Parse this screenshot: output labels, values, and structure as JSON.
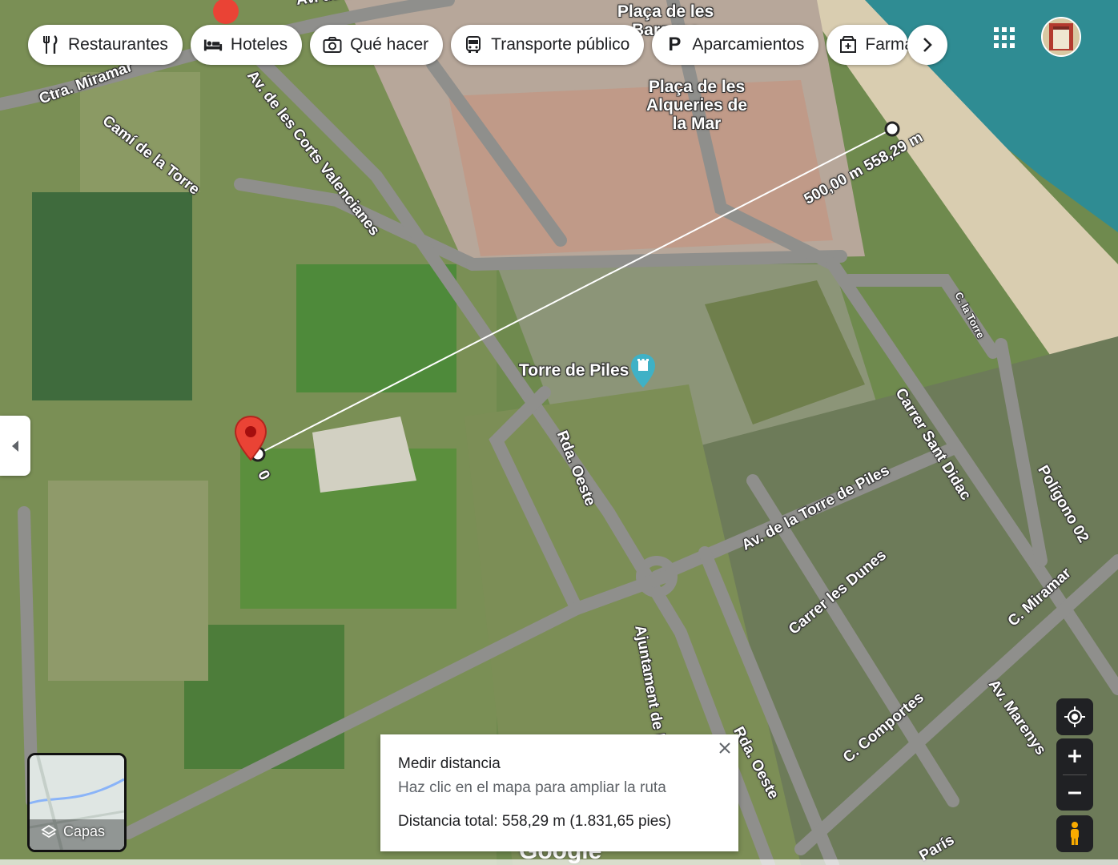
{
  "chips": [
    {
      "label": "Restaurantes",
      "icon": "fork-knife-icon"
    },
    {
      "label": "Hoteles",
      "icon": "bed-icon"
    },
    {
      "label": "Qué hacer",
      "icon": "camera-icon"
    },
    {
      "label": "Transporte público",
      "icon": "bus-icon"
    },
    {
      "label": "Aparcamientos",
      "icon": "parking-icon"
    },
    {
      "label": "Farmacias",
      "icon": "pharmacy-icon"
    }
  ],
  "streets": {
    "ctra_miramar": "Ctra. Miramar",
    "cami_torre": "Camí de la Torre",
    "corts_valencianes": "Av. de les Corts Valencianes",
    "av_safor": "Av. de la Safor",
    "rda_oeste_1": "Rda. Oeste",
    "rda_oeste_2": "Rda. Oeste",
    "ajuntament": "Ajuntament de Piles",
    "torre_piles_av": "Av. de la Torre de Piles",
    "carrer_dunes": "Carrer les Dunes",
    "c_comportes": "C. Comportes",
    "av_marenys": "Av. Marenys",
    "c_miramar": "C. Miramar",
    "poligono": "Polígono 02",
    "sant_didac": "Carrer Sant Didac",
    "c_la_torre": "C. la Torre",
    "paris": "París"
  },
  "pois": {
    "placa_top": "Plaça de les Barques",
    "placa_alqueries": "Plaça de les Alqueries de la Mar",
    "torre_piles": "Torre de Piles"
  },
  "measure_line": {
    "start_label": "0",
    "end_label": "500,00 m 558,29 m"
  },
  "measure_panel": {
    "title": "Medir distancia",
    "subtitle": "Haz clic en el mapa para ampliar la ruta",
    "total": "Distancia total: 558,29 m (1.831,65 pies)"
  },
  "layers_label": "Capas",
  "google_logo": "Google",
  "colors": {
    "accent_red": "#ea4335",
    "teal_poi": "#3fb1c6"
  }
}
